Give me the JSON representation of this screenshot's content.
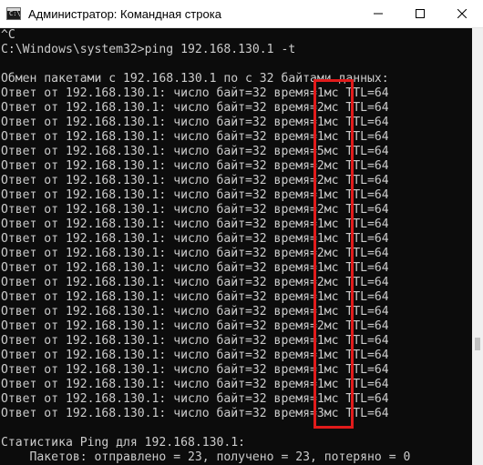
{
  "window": {
    "title": "Администратор: Командная строка",
    "icon": "cmd-icon",
    "controls": {
      "minimize": "—",
      "maximize": "☐",
      "close": "✕"
    }
  },
  "console": {
    "lines": [
      "^C",
      "C:\\Windows\\system32>ping 192.168.130.1 -t",
      "",
      "Обмен пакетами с 192.168.130.1 по с 32 байтами данных:",
      "Ответ от 192.168.130.1: число байт=32 время=1мс TTL=64",
      "Ответ от 192.168.130.1: число байт=32 время=2мс TTL=64",
      "Ответ от 192.168.130.1: число байт=32 время=1мс TTL=64",
      "Ответ от 192.168.130.1: число байт=32 время=1мс TTL=64",
      "Ответ от 192.168.130.1: число байт=32 время=5мс TTL=64",
      "Ответ от 192.168.130.1: число байт=32 время=2мс TTL=64",
      "Ответ от 192.168.130.1: число байт=32 время=2мс TTL=64",
      "Ответ от 192.168.130.1: число байт=32 время=1мс TTL=64",
      "Ответ от 192.168.130.1: число байт=32 время=2мс TTL=64",
      "Ответ от 192.168.130.1: число байт=32 время=1мс TTL=64",
      "Ответ от 192.168.130.1: число байт=32 время=1мс TTL=64",
      "Ответ от 192.168.130.1: число байт=32 время=2мс TTL=64",
      "Ответ от 192.168.130.1: число байт=32 время=1мс TTL=64",
      "Ответ от 192.168.130.1: число байт=32 время=2мс TTL=64",
      "Ответ от 192.168.130.1: число байт=32 время=1мс TTL=64",
      "Ответ от 192.168.130.1: число байт=32 время=1мс TTL=64",
      "Ответ от 192.168.130.1: число байт=32 время=2мс TTL=64",
      "Ответ от 192.168.130.1: число байт=32 время=1мс TTL=64",
      "Ответ от 192.168.130.1: число байт=32 время=1мс TTL=64",
      "Ответ от 192.168.130.1: число байт=32 время=1мс TTL=64",
      "Ответ от 192.168.130.1: число байт=32 время=1мс TTL=64",
      "Ответ от 192.168.130.1: число байт=32 время=1мс TTL=64",
      "Ответ от 192.168.130.1: число байт=32 время=3мс TTL=64",
      "",
      "Статистика Ping для 192.168.130.1:",
      "    Пакетов: отправлено = 23, получено = 23, потеряно = 0"
    ]
  },
  "colors": {
    "console_background": "#0c0c0c",
    "console_text": "#cccccc",
    "highlight_border": "#e11b1b"
  }
}
